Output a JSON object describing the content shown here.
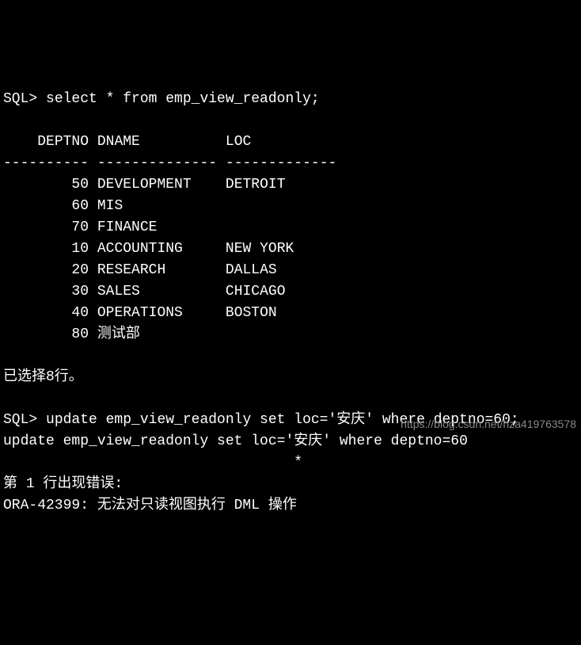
{
  "prompt1": "SQL> ",
  "query1": "select * from emp_view_readonly;",
  "headers": {
    "deptno": "DEPTNO",
    "dname": "DNAME",
    "loc": "LOC"
  },
  "separator": {
    "col1": "----------",
    "col2": "--------------",
    "col3": "-------------"
  },
  "rows": [
    {
      "deptno": "50",
      "dname": "DEVELOPMENT",
      "loc": "DETROIT"
    },
    {
      "deptno": "60",
      "dname": "MIS",
      "loc": ""
    },
    {
      "deptno": "70",
      "dname": "FINANCE",
      "loc": ""
    },
    {
      "deptno": "10",
      "dname": "ACCOUNTING",
      "loc": "NEW YORK"
    },
    {
      "deptno": "20",
      "dname": "RESEARCH",
      "loc": "DALLAS"
    },
    {
      "deptno": "30",
      "dname": "SALES",
      "loc": "CHICAGO"
    },
    {
      "deptno": "40",
      "dname": "OPERATIONS",
      "loc": "BOSTON"
    },
    {
      "deptno": "80",
      "dname": "测试部",
      "loc": ""
    }
  ],
  "rowcount_msg": "已选择8行。",
  "prompt2": "SQL> ",
  "query2": "update emp_view_readonly set loc='安庆' where deptno=60;",
  "echo_line": "update emp_view_readonly set loc='安庆' where deptno=60",
  "asterisk_marker": "                                  *",
  "error_header": "第 1 行出现错误:",
  "error_msg": "ORA-42399: 无法对只读视图执行 DML 操作",
  "watermark": "https://blog.csdn.net/hza419763578"
}
